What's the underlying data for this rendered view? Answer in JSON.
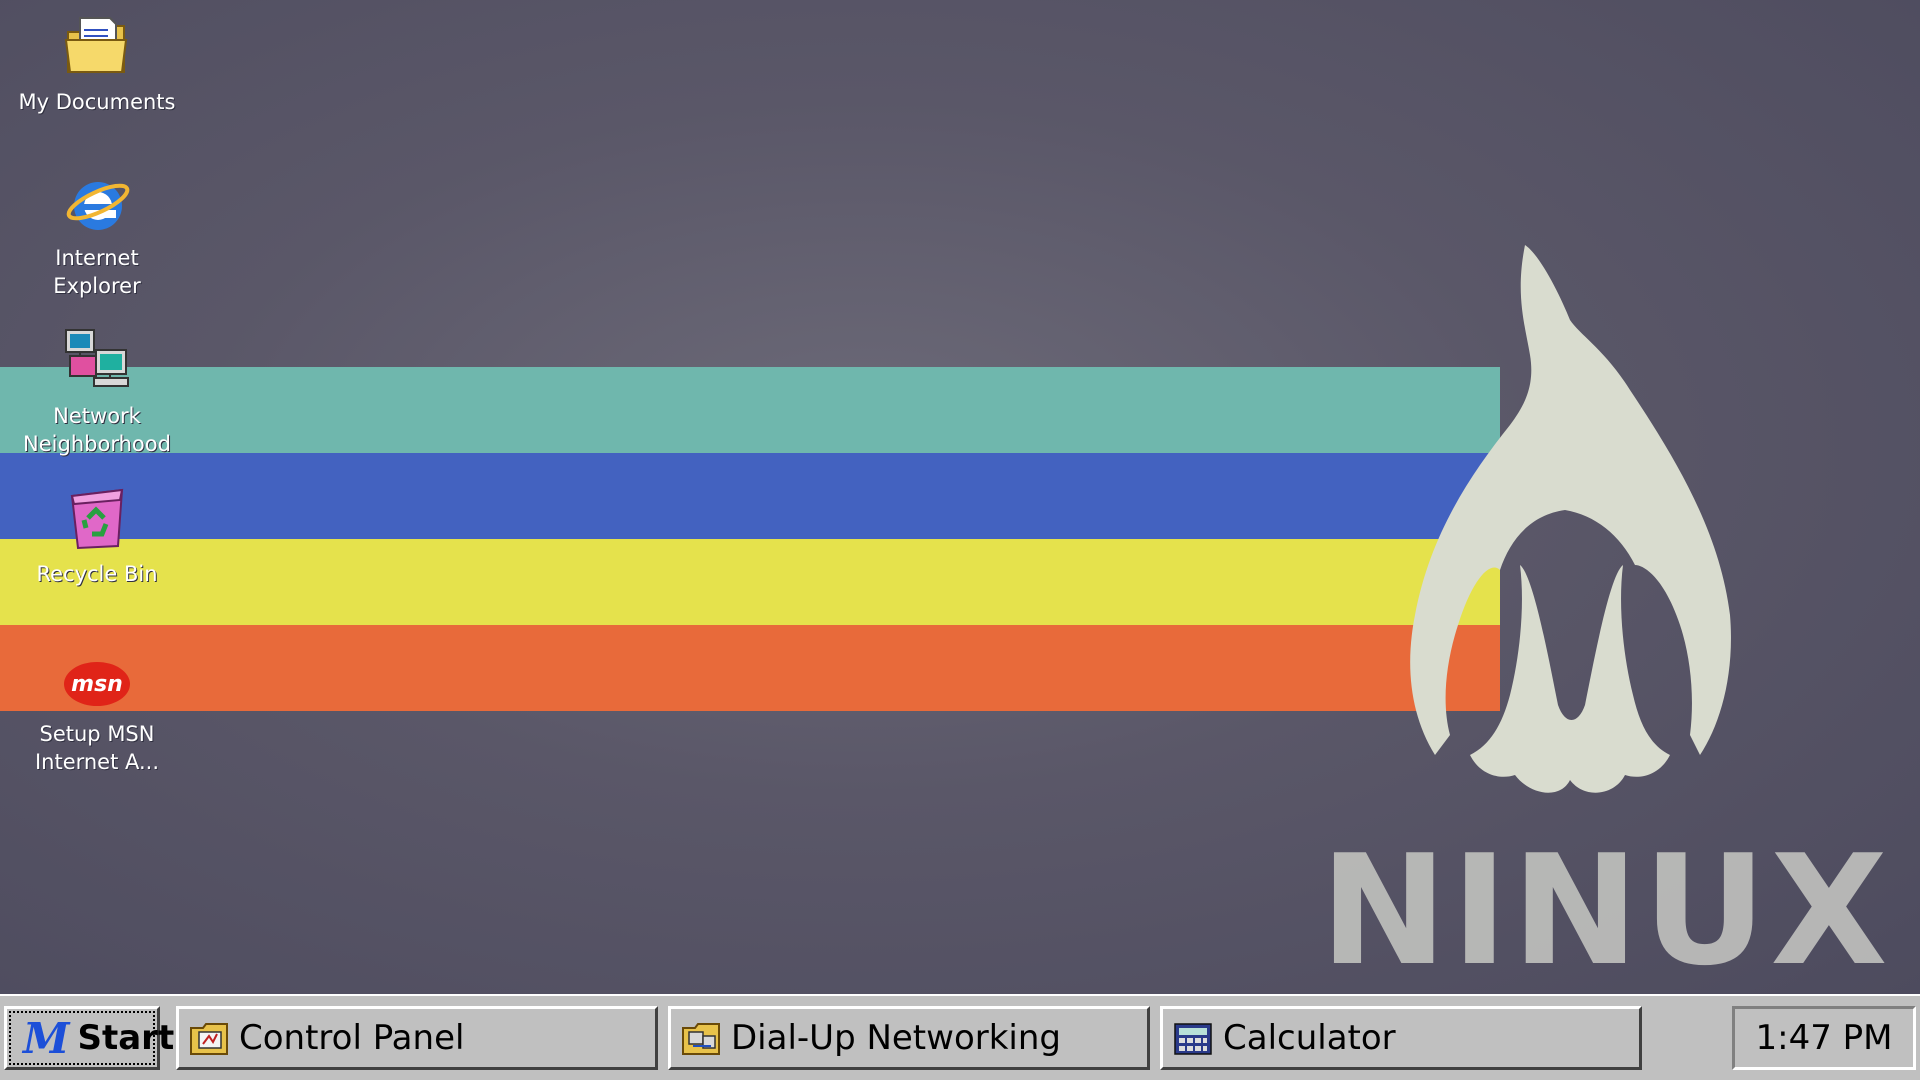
{
  "desktop": {
    "icons": [
      {
        "label": "My Documents",
        "icon": "folder-documents-icon"
      },
      {
        "label": "Internet\nExplorer",
        "icon": "internet-explorer-icon"
      },
      {
        "label": "Network\nNeighborhood",
        "icon": "network-computers-icon"
      },
      {
        "label": "Recycle Bin",
        "icon": "recycle-bin-icon"
      },
      {
        "label": "Setup MSN\nInternet A...",
        "icon": "msn-icon"
      }
    ],
    "wallpaper": {
      "logo_text": "NINUX",
      "stripe_colors": [
        "#6fb7ad",
        "#4362c0",
        "#e5e24c",
        "#e86a3a"
      ],
      "background_color": "#5a5768"
    }
  },
  "taskbar": {
    "start_label": "Start",
    "start_logo": "M",
    "tasks": [
      {
        "label": "Control Panel",
        "icon": "control-panel-icon"
      },
      {
        "label": "Dial-Up Networking",
        "icon": "dial-up-networking-icon"
      },
      {
        "label": "Calculator",
        "icon": "calculator-icon"
      }
    ],
    "clock": "1:47 PM"
  },
  "msn_icon_text": "msn"
}
